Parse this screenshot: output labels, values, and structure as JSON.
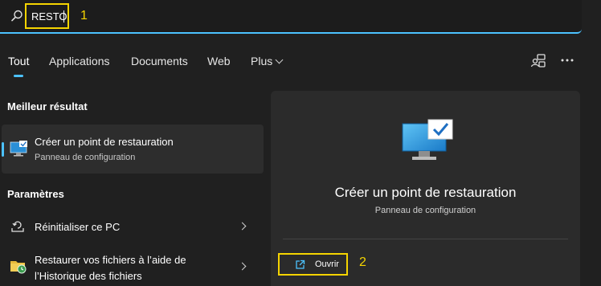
{
  "search": {
    "value": "RESTO",
    "annotation": "1"
  },
  "tabs": [
    {
      "label": "Tout"
    },
    {
      "label": "Applications"
    },
    {
      "label": "Documents"
    },
    {
      "label": "Web"
    },
    {
      "label": "Plus"
    }
  ],
  "best_match": {
    "section_title": "Meilleur résultat",
    "title": "Créer un point de restauration",
    "subtitle": "Panneau de configuration"
  },
  "settings": {
    "section_title": "Paramètres",
    "items": [
      {
        "label": "Réinitialiser ce PC"
      },
      {
        "label_line1": "Restaurer vos fichiers à l’aide de",
        "label_line2": "l’Historique des fichiers"
      }
    ]
  },
  "detail": {
    "title": "Créer un point de restauration",
    "subtitle": "Panneau de configuration",
    "open_label": "Ouvrir",
    "annotation": "2"
  },
  "colors": {
    "accent": "#4cc2ff",
    "highlight": "#f5d400",
    "background": "#202020",
    "panel": "#2b2b2b"
  }
}
